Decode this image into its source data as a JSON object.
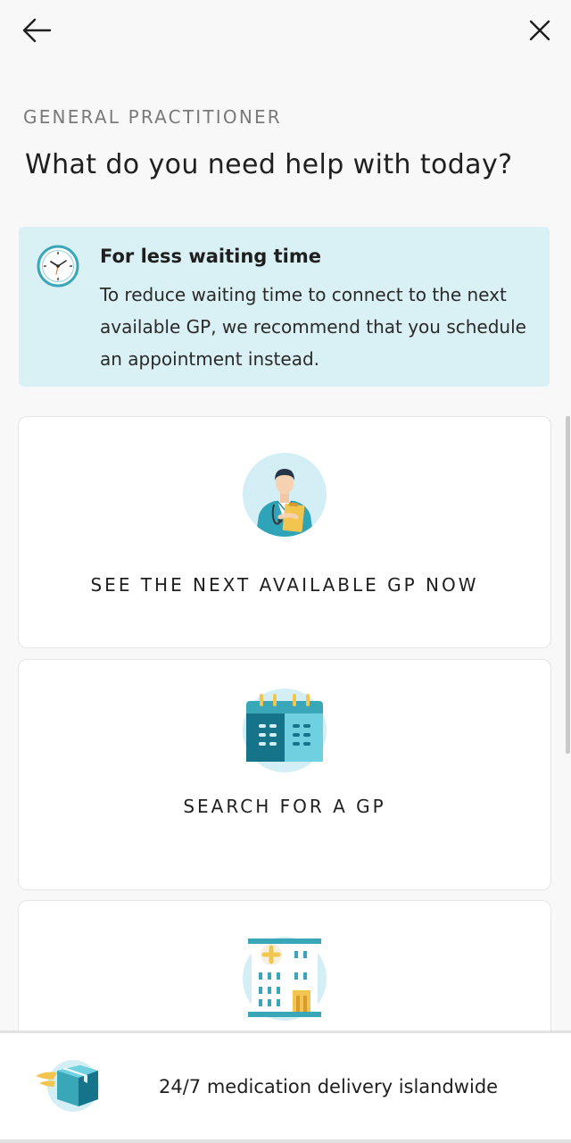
{
  "header": {
    "back_icon": "arrow-left-icon",
    "close_icon": "close-icon"
  },
  "section_label": "GENERAL PRACTITIONER",
  "title": "What do you need help with today?",
  "info": {
    "icon": "clock-icon",
    "title": "For less waiting time",
    "text": "To reduce waiting time to connect to the next available GP, we recommend that you schedule an appointment instead."
  },
  "options": [
    {
      "label": "SEE THE NEXT AVAILABLE GP NOW",
      "icon": "doctor-icon"
    },
    {
      "label": "SEARCH FOR A GP",
      "icon": "calendar-icon"
    },
    {
      "label": "",
      "icon": "clinic-building-icon"
    }
  ],
  "banner": {
    "icon": "delivery-box-icon",
    "text": "24/7 medication delivery islandwide"
  },
  "colors": {
    "accent": "#3aa7b8",
    "info_bg": "#d9f0f5",
    "illustration_circle": "#d3eff5",
    "calendar_yellow": "#f2c450"
  }
}
